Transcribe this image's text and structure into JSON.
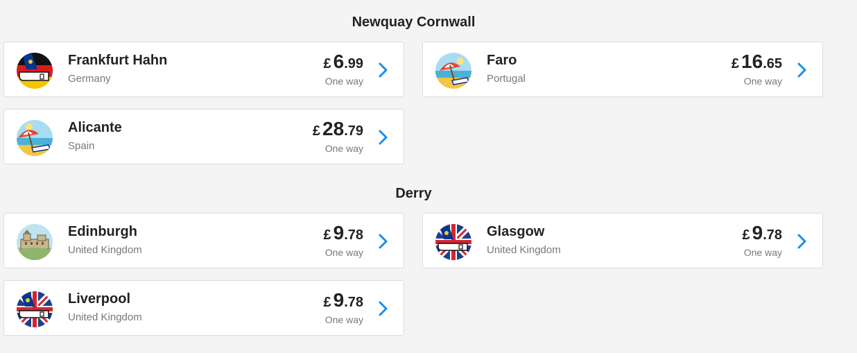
{
  "groups": [
    {
      "title": "Newquay Cornwall",
      "destinations": [
        {
          "city": "Frankfurt Hahn",
          "country": "Germany",
          "currency": "£",
          "price_int": "6",
          "price_dec": ".99",
          "fare_type": "One way",
          "icon": "germany-flag-plane-icon"
        },
        {
          "city": "Faro",
          "country": "Portugal",
          "currency": "£",
          "price_int": "16",
          "price_dec": ".65",
          "fare_type": "One way",
          "icon": "beach-umbrella-icon"
        },
        {
          "city": "Alicante",
          "country": "Spain",
          "currency": "£",
          "price_int": "28",
          "price_dec": ".79",
          "fare_type": "One way",
          "icon": "beach-umbrella-icon"
        }
      ]
    },
    {
      "title": "Derry",
      "destinations": [
        {
          "city": "Edinburgh",
          "country": "United Kingdom",
          "currency": "£",
          "price_int": "9",
          "price_dec": ".78",
          "fare_type": "One way",
          "icon": "castle-icon"
        },
        {
          "city": "Glasgow",
          "country": "United Kingdom",
          "currency": "£",
          "price_int": "9",
          "price_dec": ".78",
          "fare_type": "One way",
          "icon": "uk-flag-plane-icon"
        },
        {
          "city": "Liverpool",
          "country": "United Kingdom",
          "currency": "£",
          "price_int": "9",
          "price_dec": ".78",
          "fare_type": "One way",
          "icon": "uk-flag-plane-icon"
        }
      ]
    }
  ],
  "colors": {
    "chevron": "#1b8ee0",
    "background": "#f4f4f4",
    "card": "#ffffff"
  }
}
